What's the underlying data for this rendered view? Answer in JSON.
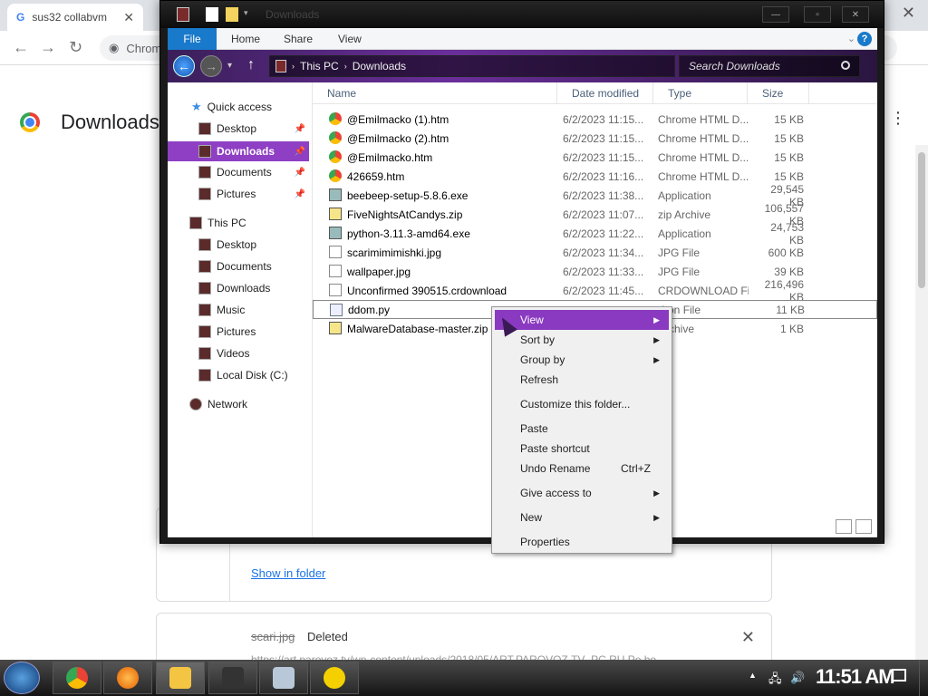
{
  "chrome": {
    "tab1_title": "sus32 collabvm",
    "omnibox_text": "Chrom",
    "page_title": "Downloads",
    "show_in_folder": "Show in folder",
    "deleted_file": "scari.jpg",
    "deleted_status": "Deleted",
    "deleted_url": "https://art.parovoz.tv/wp-content/uploads/2018/05/ART.PAROVOZ.TV_PC.RU.Po.bo...",
    "card_close": "✕"
  },
  "explorer": {
    "title": "Downloads",
    "ribbon": {
      "file": "File",
      "home": "Home",
      "share": "Share",
      "view": "View"
    },
    "address": {
      "crumb1": "This PC",
      "crumb2": "Downloads",
      "search_placeholder": "Search Downloads"
    },
    "nav": {
      "quick_access": "Quick access",
      "qa_desktop": "Desktop",
      "qa_downloads": "Downloads",
      "qa_documents": "Documents",
      "qa_pictures": "Pictures",
      "this_pc": "This PC",
      "pc_desktop": "Desktop",
      "pc_documents": "Documents",
      "pc_downloads": "Downloads",
      "pc_music": "Music",
      "pc_pictures": "Pictures",
      "pc_videos": "Videos",
      "pc_local_disk": "Local Disk (C:)",
      "network": "Network"
    },
    "columns": {
      "name": "Name",
      "date": "Date modified",
      "type": "Type",
      "size": "Size"
    },
    "files": [
      {
        "name": "@Emilmacko (1).htm",
        "date": "6/2/2023 11:15...",
        "type": "Chrome HTML D...",
        "size": "15 KB",
        "icon": "chrome"
      },
      {
        "name": "@Emilmacko (2).htm",
        "date": "6/2/2023 11:15...",
        "type": "Chrome HTML D...",
        "size": "15 KB",
        "icon": "chrome"
      },
      {
        "name": "@Emilmacko.htm",
        "date": "6/2/2023 11:15...",
        "type": "Chrome HTML D...",
        "size": "15 KB",
        "icon": "chrome"
      },
      {
        "name": "426659.htm",
        "date": "6/2/2023 11:16...",
        "type": "Chrome HTML D...",
        "size": "15 KB",
        "icon": "chrome"
      },
      {
        "name": "beebeep-setup-5.8.6.exe",
        "date": "6/2/2023 11:38...",
        "type": "Application",
        "size": "29,545 KB",
        "icon": "exe"
      },
      {
        "name": "FiveNightsAtCandys.zip",
        "date": "6/2/2023 11:07...",
        "type": "zip Archive",
        "size": "106,557 KB",
        "icon": "zip"
      },
      {
        "name": "python-3.11.3-amd64.exe",
        "date": "6/2/2023 11:22...",
        "type": "Application",
        "size": "24,753 KB",
        "icon": "exe"
      },
      {
        "name": "scarimimimishki.jpg",
        "date": "6/2/2023 11:34...",
        "type": "JPG File",
        "size": "600 KB",
        "icon": "jpg"
      },
      {
        "name": "wallpaper.jpg",
        "date": "6/2/2023 11:33...",
        "type": "JPG File",
        "size": "39 KB",
        "icon": "jpg"
      },
      {
        "name": "Unconfirmed 390515.crdownload",
        "date": "6/2/2023 11:45...",
        "type": "CRDOWNLOAD File",
        "size": "216,496 KB",
        "icon": "jpg"
      },
      {
        "name": "ddom.py",
        "date": "",
        "type": "thon File",
        "size": "11 KB",
        "icon": "py"
      },
      {
        "name": "MalwareDatabase-master.zip",
        "date": "",
        "type": "Archive",
        "size": "1 KB",
        "icon": "zip"
      }
    ]
  },
  "context_menu": {
    "view": "View",
    "sort_by": "Sort by",
    "group_by": "Group by",
    "refresh": "Refresh",
    "customize": "Customize this folder...",
    "paste": "Paste",
    "paste_shortcut": "Paste shortcut",
    "undo_rename": "Undo Rename",
    "undo_shortcut": "Ctrl+Z",
    "give_access": "Give access to",
    "new": "New",
    "properties": "Properties"
  },
  "taskbar": {
    "clock": "11:51 AM"
  }
}
